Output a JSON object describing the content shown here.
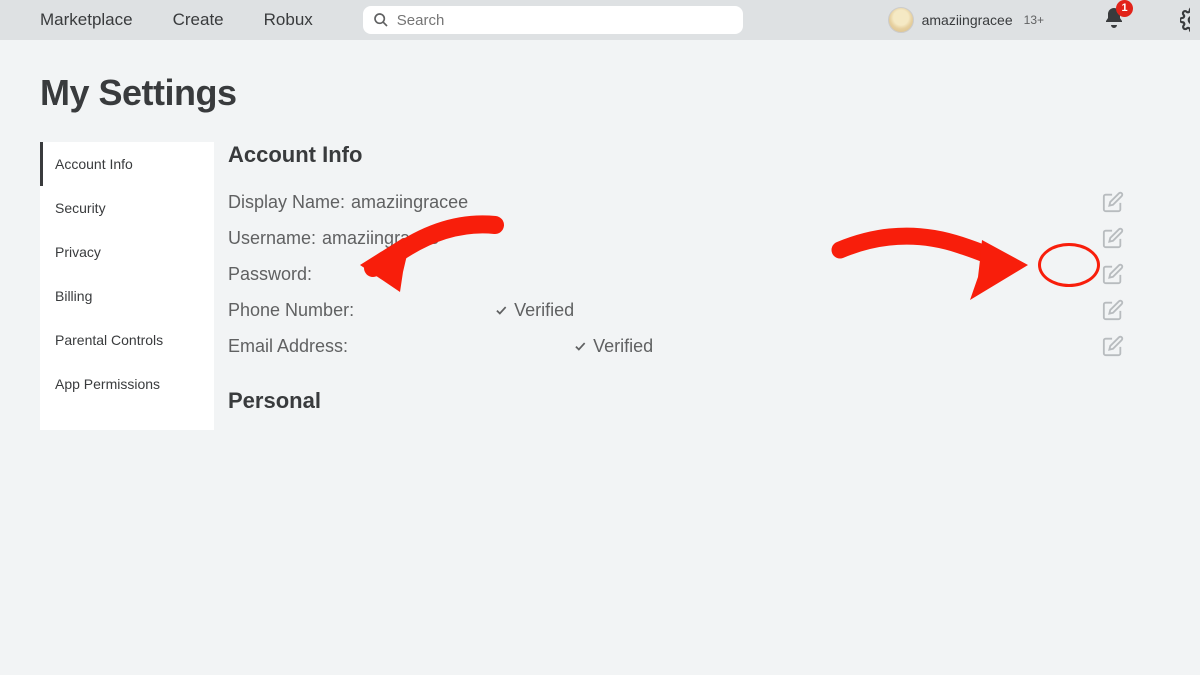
{
  "topnav": {
    "links": [
      "Marketplace",
      "Create",
      "Robux"
    ],
    "search_placeholder": "Search",
    "username": "amaziingracee",
    "age_tag": "13+",
    "notif_count": "1"
  },
  "page_title": "My Settings",
  "sidebar": {
    "items": [
      {
        "label": "Account Info",
        "active": true
      },
      {
        "label": "Security",
        "active": false
      },
      {
        "label": "Privacy",
        "active": false
      },
      {
        "label": "Billing",
        "active": false
      },
      {
        "label": "Parental Controls",
        "active": false
      },
      {
        "label": "App Permissions",
        "active": false
      }
    ]
  },
  "sections": {
    "account_info": {
      "title": "Account Info",
      "fields": {
        "display_name": {
          "label": "Display Name:",
          "value": "amaziingracee"
        },
        "username": {
          "label": "Username:",
          "value": "amaziingracee"
        },
        "password": {
          "label": "Password:",
          "value": ""
        },
        "phone": {
          "label": "Phone Number:",
          "value": "",
          "verified_text": "Verified"
        },
        "email": {
          "label": "Email Address:",
          "value": "",
          "verified_text": "Verified"
        }
      }
    },
    "personal": {
      "title": "Personal"
    }
  },
  "annotation_color": "#f81e0b"
}
